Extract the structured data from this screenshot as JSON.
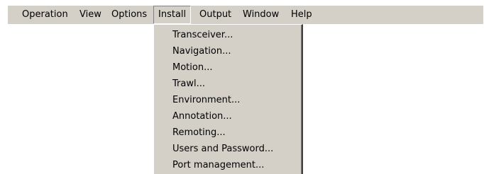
{
  "menubar": {
    "items": [
      {
        "label": "Operation"
      },
      {
        "label": "View"
      },
      {
        "label": "Options"
      },
      {
        "label": "Install"
      },
      {
        "label": "Output"
      },
      {
        "label": "Window"
      },
      {
        "label": "Help"
      }
    ]
  },
  "install_menu": {
    "items": [
      {
        "label": "Transceiver..."
      },
      {
        "label": "Navigation..."
      },
      {
        "label": "Motion..."
      },
      {
        "label": "Trawl..."
      },
      {
        "label": "Environment..."
      },
      {
        "label": "Annotation..."
      },
      {
        "label": "Remoting..."
      },
      {
        "label": "Users and Password..."
      },
      {
        "label": "Port management..."
      }
    ]
  },
  "colors": {
    "menu_background": "#d4d0c8",
    "text": "#000000"
  }
}
